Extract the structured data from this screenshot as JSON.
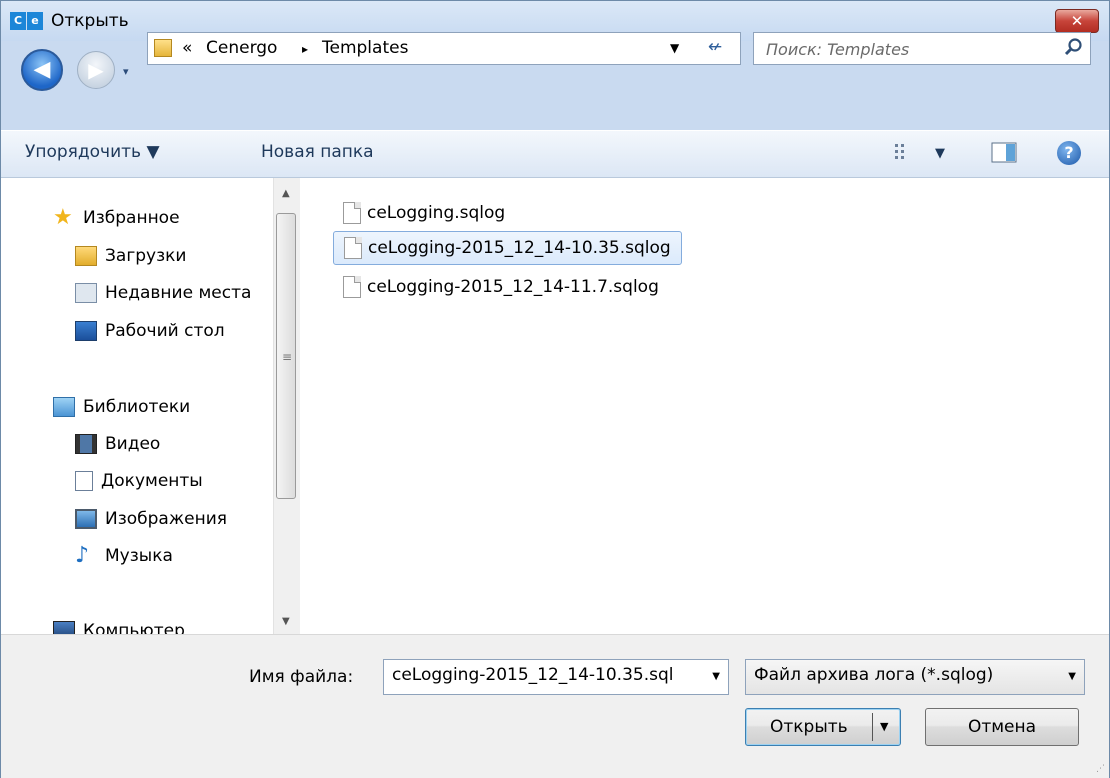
{
  "window": {
    "title": "Открыть",
    "app_icon_left": "C",
    "app_icon_right": "e",
    "close_glyph": "✕"
  },
  "navigation": {
    "back_glyph": "◀",
    "forward_glyph": "▶",
    "history_glyph": "▾",
    "breadcrumb": {
      "overflow": "«",
      "items": [
        "Cenergo",
        "Templates"
      ],
      "separator": "▸"
    },
    "dropdown_glyph": "▼",
    "refresh_glyph": "↚"
  },
  "search": {
    "placeholder": "Поиск: Templates"
  },
  "toolbar": {
    "organize_label": "Упорядочить ▼",
    "new_folder_label": "Новая папка",
    "view_menu_glyph": "▼",
    "help_glyph": "?"
  },
  "sidebar": {
    "groups": [
      {
        "label": "Избранное",
        "items": [
          {
            "label": "Загрузки"
          },
          {
            "label": "Недавние места"
          },
          {
            "label": "Рабочий стол"
          }
        ]
      },
      {
        "label": "Библиотеки",
        "items": [
          {
            "label": "Видео"
          },
          {
            "label": "Документы"
          },
          {
            "label": "Изображения"
          },
          {
            "label": "Музыка"
          }
        ]
      },
      {
        "label": "Компьютер",
        "items": []
      }
    ]
  },
  "scrollbar": {
    "up_glyph": "▲",
    "down_glyph": "▼",
    "grip": "≡"
  },
  "files": [
    {
      "name": "ceLogging.sqlog",
      "selected": false
    },
    {
      "name": "ceLogging-2015_12_14-10.35.sqlog",
      "selected": true
    },
    {
      "name": "ceLogging-2015_12_14-11.7.sqlog",
      "selected": false
    }
  ],
  "footer": {
    "filename_label": "Имя файла:",
    "filename_value": "ceLogging-2015_12_14-10.35.sql",
    "filename_dropdown_glyph": "▼",
    "filetype_value": "Файл архива лога (*.sqlog)",
    "filetype_dropdown_glyph": "▼",
    "open_label": "Открыть",
    "open_split_glyph": "▼",
    "cancel_label": "Отмена",
    "resize_grip": "⋰"
  },
  "colors": {
    "accent": "#1e66c8",
    "selection_border": "#84acdd",
    "window_frame": "#c9daf0"
  }
}
